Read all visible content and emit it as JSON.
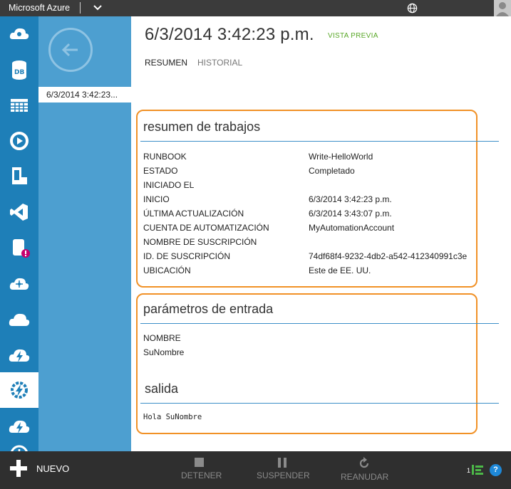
{
  "topbar": {
    "brand": "Microsoft Azure"
  },
  "nav": {
    "items": [
      {
        "name": "cloud-services-icon"
      },
      {
        "name": "sql-databases-icon"
      },
      {
        "name": "storage-icon"
      },
      {
        "name": "media-services-icon"
      },
      {
        "name": "mobile-services-icon"
      },
      {
        "name": "visual-studio-icon"
      },
      {
        "name": "hdinsight-icon"
      },
      {
        "name": "service-bus-icon"
      },
      {
        "name": "cloud-icon"
      },
      {
        "name": "cloud-bolt-icon"
      },
      {
        "name": "automation-icon",
        "active": true
      },
      {
        "name": "cloud-bolt-2-icon"
      },
      {
        "name": "scheduler-icon"
      }
    ]
  },
  "panel2": {
    "selected_item": "6/3/2014 3:42:23..."
  },
  "header": {
    "title": "6/3/2014 3:42:23 p.m.",
    "badge": "VISTA PREVIA",
    "tabs": [
      {
        "label": "RESUMEN",
        "active": true
      },
      {
        "label": "HISTORIAL",
        "active": false
      }
    ]
  },
  "job_summary": {
    "title": "resumen de trabajos",
    "rows": [
      {
        "label": "RUNBOOK",
        "value": "Write-HelloWorld"
      },
      {
        "label": "ESTADO",
        "value": "Completado"
      },
      {
        "label": "INICIADO EL",
        "value": ""
      },
      {
        "label": "INICIO",
        "value": "6/3/2014 3:42:23 p.m."
      },
      {
        "label": "ÚLTIMA ACTUALIZACIÓN",
        "value": "6/3/2014 3:43:07 p.m."
      },
      {
        "label": "CUENTA DE AUTOMATIZACIÓN",
        "value": "MyAutomationAccount"
      },
      {
        "label": "NOMBRE DE SUSCRIPCIÓN",
        "value": ""
      },
      {
        "label": "ID. DE SUSCRIPCIÓN",
        "value": "74df68f4-9232-4db2-a542-412340991c3e"
      },
      {
        "label": "UBICACIÓN",
        "value": "Este de EE. UU."
      }
    ]
  },
  "input_params": {
    "title": "parámetros de entrada",
    "param_name": "NOMBRE",
    "param_value": "SuNombre"
  },
  "output": {
    "title": "salida",
    "text": "Hola SuNombre"
  },
  "commandbar": {
    "new_label": "NUEVO",
    "stop_label": "DETENER",
    "suspend_label": "SUSPENDER",
    "resume_label": "REANUDAR",
    "status_count": "1",
    "help_label": "?"
  },
  "colors": {
    "accent_blue": "#1e7fb8",
    "section_border": "#f19126",
    "preview_green": "#5aa829"
  }
}
